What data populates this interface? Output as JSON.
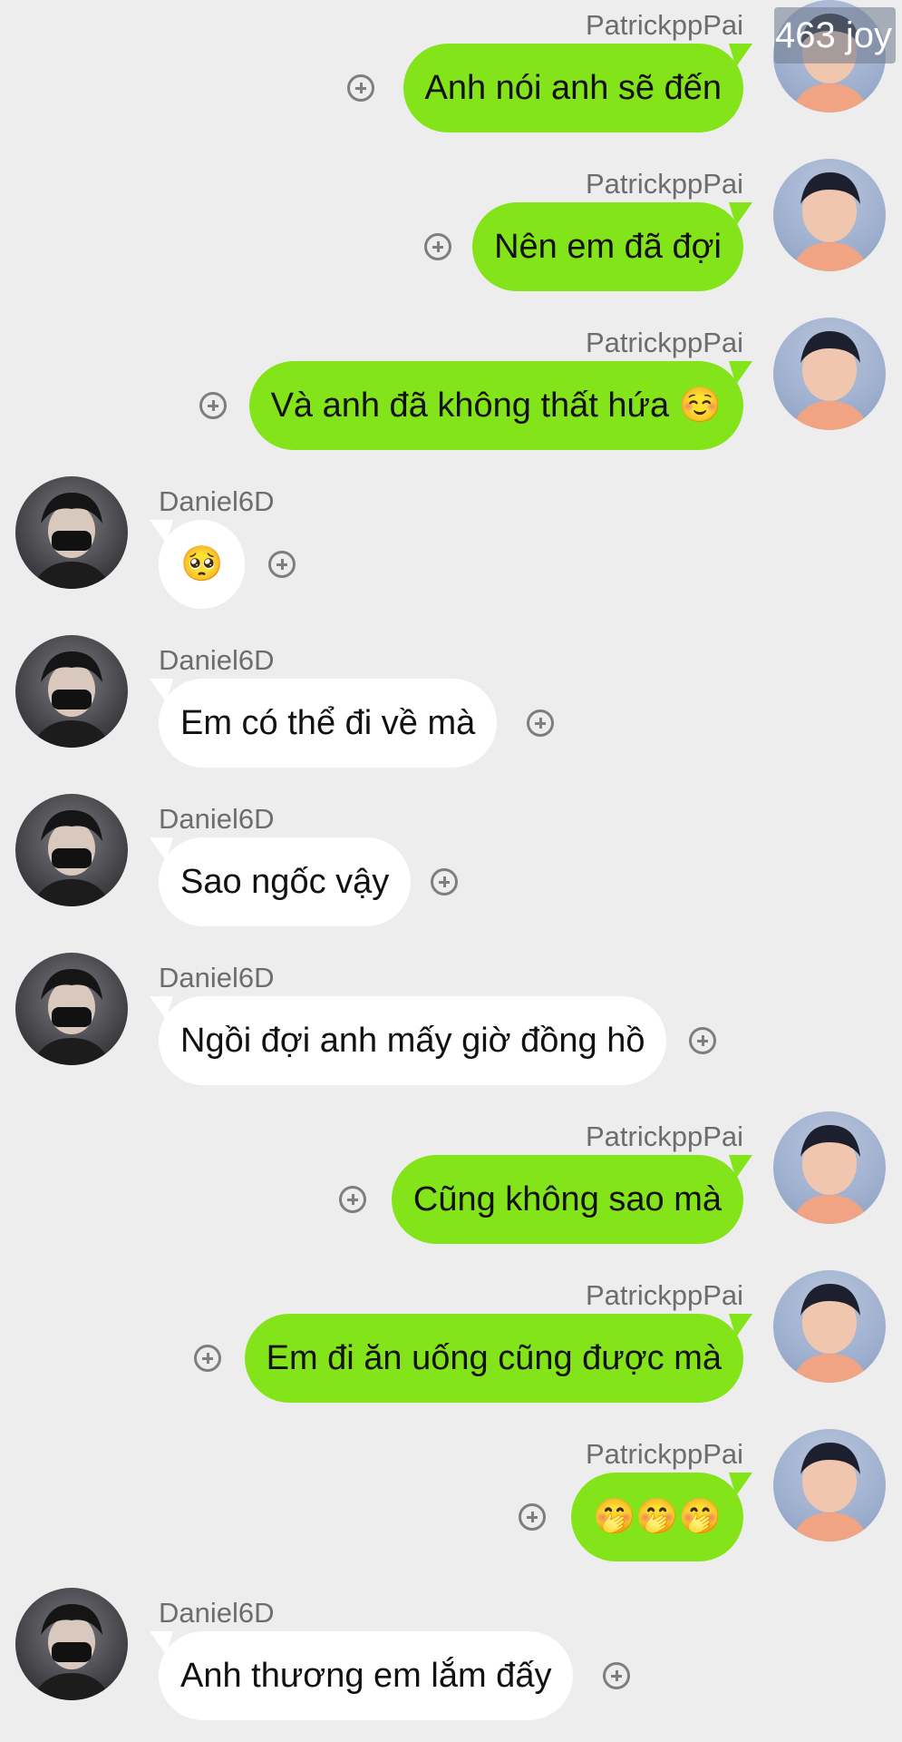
{
  "badge": {
    "text": "463 joy"
  },
  "users": {
    "right": {
      "name": "PatrickppPai"
    },
    "left": {
      "name": "Daniel6D"
    }
  },
  "messages": [
    {
      "side": "right",
      "sender": "PatrickppPai",
      "text": "Anh nói anh sẽ đến"
    },
    {
      "side": "right",
      "sender": "PatrickppPai",
      "text": "Nên em đã đợi"
    },
    {
      "side": "right",
      "sender": "PatrickppPai",
      "text": "Và anh đã không thất hứa ☺️"
    },
    {
      "side": "left",
      "sender": "Daniel6D",
      "text": "🥺"
    },
    {
      "side": "left",
      "sender": "Daniel6D",
      "text": "Em có thể đi về mà"
    },
    {
      "side": "left",
      "sender": "Daniel6D",
      "text": "Sao ngốc vậy"
    },
    {
      "side": "left",
      "sender": "Daniel6D",
      "text": "Ngồi đợi anh mấy giờ đồng hồ"
    },
    {
      "side": "right",
      "sender": "PatrickppPai",
      "text": "Cũng không sao mà"
    },
    {
      "side": "right",
      "sender": "PatrickppPai",
      "text": "Em đi ăn uống cũng được mà"
    },
    {
      "side": "right",
      "sender": "PatrickppPai",
      "text": "🤭🤭🤭"
    },
    {
      "side": "left",
      "sender": "Daniel6D",
      "text": "Anh thương em lắm đấy"
    }
  ],
  "colors": {
    "background": "#ededed",
    "sent_bubble": "#84e41a",
    "received_bubble": "#ffffff",
    "name_text": "#6d6d6d"
  },
  "icons": {
    "add_reaction": "circle-plus-icon",
    "avatar": "user-avatar"
  }
}
